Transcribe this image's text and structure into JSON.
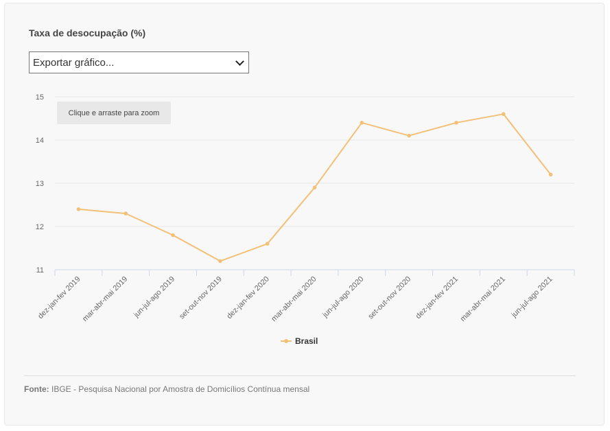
{
  "export_select": {
    "value": "Exportar gráfico..."
  },
  "zoom_hint": "Clique e arraste para zoom",
  "footer": {
    "source_label": "Fonte:",
    "source_text": "IBGE - Pesquisa Nacional por Amostra de Domicílios Contínua mensal"
  },
  "colors": {
    "series": "#f2c077",
    "grid": "#e6e6e6",
    "axis": "#ccd6eb"
  },
  "chart_data": {
    "type": "line",
    "title": "Taxa de desocupação (%)",
    "xlabel": "",
    "ylabel": "",
    "ylim": [
      11,
      15
    ],
    "yticks": [
      11,
      12,
      13,
      14,
      15
    ],
    "grid": true,
    "legend_position": "bottom-center",
    "categories": [
      "dez-jan-fev 2019",
      "mar-abr-mai 2019",
      "jun-jul-ago 2019",
      "set-out-nov 2019",
      "dez-jan-fev 2020",
      "mar-abr-mai 2020",
      "jun-jul-ago 2020",
      "set-out-nov 2020",
      "dez-jan-fev 2021",
      "mar-abr-mai 2021",
      "jun-jul-ago 2021"
    ],
    "series": [
      {
        "name": "Brasil",
        "values": [
          12.4,
          12.3,
          11.8,
          11.2,
          11.6,
          12.9,
          14.4,
          14.1,
          14.4,
          14.6,
          13.2
        ]
      }
    ]
  }
}
